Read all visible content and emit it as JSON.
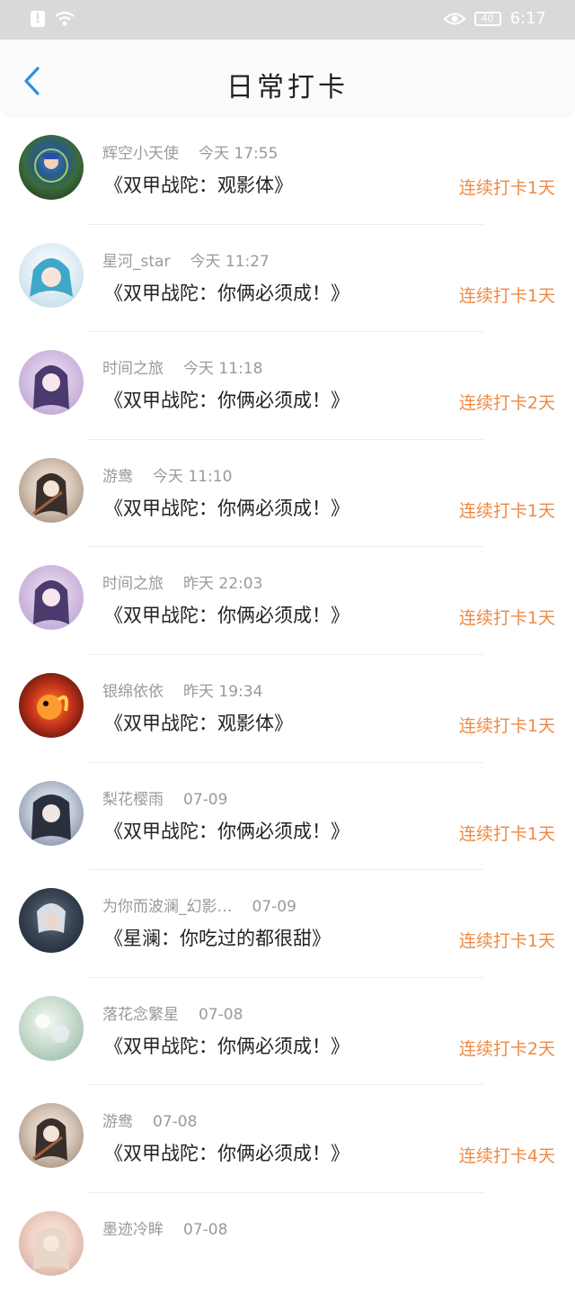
{
  "status_bar": {
    "battery": "40",
    "time": "6:17",
    "icons": [
      "alert-icon",
      "wifi-icon",
      "eye-icon",
      "battery-icon"
    ]
  },
  "header": {
    "title": "日常打卡",
    "back_icon": "chevron-left-icon"
  },
  "colors": {
    "accent": "#ee8a43",
    "back": "#2f8fe0",
    "status_bar": "#d9d9d9"
  },
  "checkins": [
    {
      "user": "辉空小天使",
      "time": "今天 17:55",
      "content": "《双甲战陀：观影体》",
      "streak": "连续打卡1天"
    },
    {
      "user": "星河_star",
      "time": "今天 11:27",
      "content": "《双甲战陀：你俩必须成！》",
      "streak": "连续打卡1天"
    },
    {
      "user": "时间之旅",
      "time": "今天 11:18",
      "content": "《双甲战陀：你俩必须成！》",
      "streak": "连续打卡2天"
    },
    {
      "user": "游鸯",
      "time": "今天 11:10",
      "content": "《双甲战陀：你俩必须成！》",
      "streak": "连续打卡1天"
    },
    {
      "user": "时间之旅",
      "time": "昨天 22:03",
      "content": "《双甲战陀：你俩必须成！》",
      "streak": "连续打卡1天"
    },
    {
      "user": "银绵依依",
      "time": "昨天 19:34",
      "content": "《双甲战陀：观影体》",
      "streak": "连续打卡1天"
    },
    {
      "user": "梨花樱雨",
      "time": "07-09",
      "content": "《双甲战陀：你俩必须成！》",
      "streak": "连续打卡1天"
    },
    {
      "user": "为你而波澜_幻影…",
      "time": "07-09",
      "content": "《星澜：你吃过的都很甜》",
      "streak": "连续打卡1天"
    },
    {
      "user": "落花念繁星",
      "time": "07-08",
      "content": "《双甲战陀：你俩必须成！》",
      "streak": "连续打卡2天"
    },
    {
      "user": "游鸯",
      "time": "07-08",
      "content": "《双甲战陀：你俩必须成！》",
      "streak": "连续打卡4天"
    },
    {
      "user": "墨迹冷眸",
      "time": "07-08",
      "content": "",
      "streak": ""
    }
  ]
}
